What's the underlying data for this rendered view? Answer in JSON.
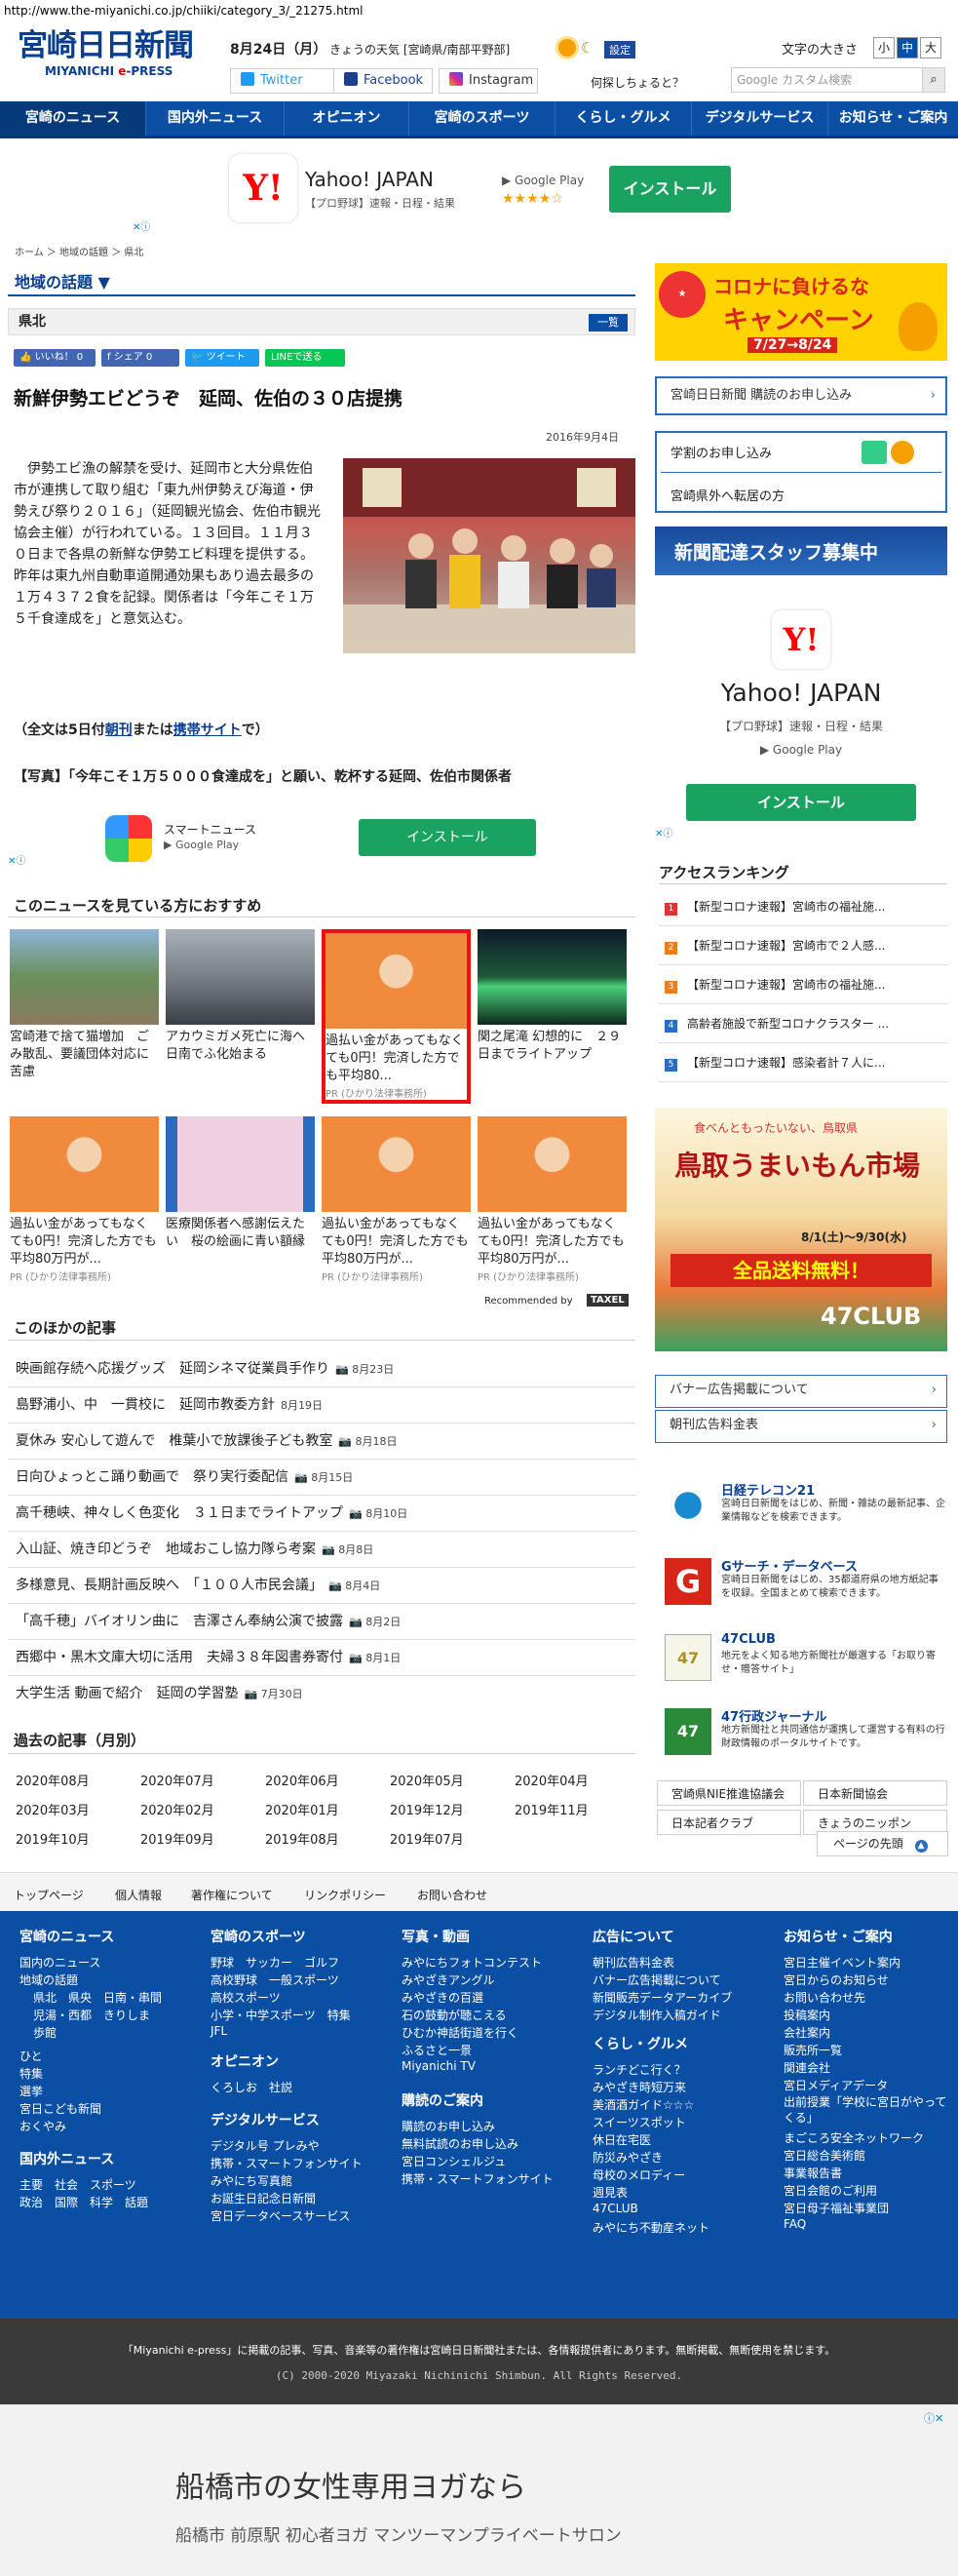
{
  "url": "http://www.the-miyanichi.co.jp/chiiki/category_3/_21275.html",
  "header": {
    "logo_main": "宮崎日日新聞",
    "logo_sub_a": "MIYANICHI ",
    "logo_sub_b": "e",
    "logo_sub_c": "-PRESS",
    "date": "8月24日（月）",
    "weather": "きょうの天気 [宮崎県/南部平野部]",
    "settei": "設定",
    "twitter": "Twitter",
    "facebook": "Facebook",
    "instagram": "Instagram",
    "what": "何探しちょると？",
    "fontsize_label": "文字の大きさ",
    "fs_small": "小",
    "fs_mid": "中",
    "fs_large": "大",
    "search_placeholder": "Google カスタム検索",
    "search_icon": "magnifier"
  },
  "nav": [
    "宮崎のニュース",
    "国内外ニュース",
    "オピニオン",
    "宮崎のスポーツ",
    "くらし・グルメ",
    "デジタルサービス",
    "お知らせ・ご案内"
  ],
  "ad_top": {
    "brand": "Y!",
    "title": "Yahoo! JAPAN",
    "desc": "【プロ野球】速報・日程・結果",
    "store": "▶ Google Play",
    "stars": "★★★★☆",
    "install": "インストール"
  },
  "breadcrumb": "ホーム ＞ 地域の話題 ＞ 県北",
  "section_title": "地域の話題 ▼",
  "subsection": "県北",
  "ichiran": "一覧",
  "share": {
    "like": "👍 いいね！ 0",
    "share": "f シェア 0",
    "tweet": "🐦 ツイート",
    "line": "LINEで送る"
  },
  "article": {
    "title": "新鮮伊勢エビどうぞ　延岡、佐伯の３０店提携",
    "date": "2016年9月4日",
    "body": "　伊勢エビ漁の解禁を受け、延岡市と大分県佐伯市が連携して取り組む「東九州伊勢えび海道・伊勢えび祭り２０１６」（延岡観光協会、佐伯市観光協会主催）が行われている。１３回目。１１月３０日まで各県の新鮮な伊勢エビ料理を提供する。昨年は東九州自動車道開通効果もあり過去最多の１万４３７２食を記録。関係者は「今年こそ１万５千食達成を」と意気込む。",
    "full_a": "（全文は5日付",
    "full_link1": "朝刊",
    "full_b": "または",
    "full_link2": "携帯サイト",
    "full_c": "で）",
    "caption": "【写真】「今年こそ１万５０００食達成を」と願い、乾杯する延岡、佐伯市関係者"
  },
  "ad_small": {
    "title": "スマートニュース",
    "store": "▶ Google Play",
    "install": "インストール"
  },
  "recommend_title": "このニュースを見ている方におすすめ",
  "recommend": [
    {
      "text": "宮崎港で捨て猫増加　ごみ散乱、要議団体対応に苦慮",
      "pr": ""
    },
    {
      "text": "アカウミガメ死亡に海へ　日南でふ化始まる",
      "pr": ""
    },
    {
      "text": "過払い金があってもなくても0円！完済した方でも平均80...",
      "pr": "PR (ひかり法律事務所)"
    },
    {
      "text": "関之尾滝 幻想的に　２９日までライトアップ",
      "pr": ""
    },
    {
      "text": "過払い金があってもなくても0円！完済した方でも平均80万円が...",
      "pr": "PR (ひかり法律事務所)"
    },
    {
      "text": "医療関係者へ感謝伝えたい　桜の絵画に青い額縁",
      "pr": ""
    },
    {
      "text": "過払い金があってもなくても0円！完済した方でも平均80万円が...",
      "pr": "PR (ひかり法律事務所)"
    },
    {
      "text": "過払い金があってもなくても0円！完済した方でも平均80万円が...",
      "pr": "PR (ひかり法律事務所)"
    }
  ],
  "recommended_by": "Recommended by",
  "taxel": "TAXEL",
  "other_title": "このほかの記事",
  "others": [
    {
      "t": "映画館存続へ応援グッズ　延岡シネマ従業員手作り",
      "d": "📷 8月23日"
    },
    {
      "t": "島野浦小、中　一貫校に　延岡市教委方針",
      "d": "8月19日"
    },
    {
      "t": "夏休み 安心して遊んで　椎葉小で放課後子ども教室",
      "d": "📷 8月18日"
    },
    {
      "t": "日向ひょっとこ踊り動画で　祭り実行委配信",
      "d": "📷 8月15日"
    },
    {
      "t": "高千穂峡、神々しく色変化　３１日までライトアップ",
      "d": "📷 8月10日"
    },
    {
      "t": "入山証、焼き印どうぞ　地域おこし協力隊ら考案",
      "d": "📷 8月8日"
    },
    {
      "t": "多様意見、長期計画反映へ　「１００人市民会議」",
      "d": "📷 8月4日"
    },
    {
      "t": "「高千穂」バイオリン曲に　吉澤さん奉納公演で披露",
      "d": "📷 8月2日"
    },
    {
      "t": "西郷中・黒木文庫大切に活用　夫婦３８年図書券寄付",
      "d": "📷 8月1日"
    },
    {
      "t": "大学生活 動画で紹介　延岡の学習塾",
      "d": "📷 7月30日"
    }
  ],
  "past_title": "過去の記事（月別）",
  "months": [
    "2020年08月",
    "2020年07月",
    "2020年06月",
    "2020年05月",
    "2020年04月",
    "2020年03月",
    "2020年02月",
    "2020年01月",
    "2019年12月",
    "2019年11月",
    "2019年10月",
    "2019年09月",
    "2019年08月",
    "2019年07月"
  ],
  "sidebar": {
    "campaign_top": "コロナに負けるな",
    "campaign_main": "キャンペーン",
    "campaign_date": "7/27→8/24",
    "apply": "宮崎日日新聞 購読のお申し込み",
    "gakushu": "学割のお申し込み",
    "tenkyo": "宮崎県外へ転居の方",
    "recruit": "新聞配達スタッフ募集中",
    "yahoo_title": "Yahoo! JAPAN",
    "yahoo_desc": "【プロ野球】速報・日程・結果",
    "yahoo_store": "▶ Google Play",
    "yahoo_install": "インストール",
    "rank_title": "アクセスランキング",
    "ranking": [
      "【新型コロナ速報】宮崎市の福祉施...",
      "【新型コロナ速報】宮崎市で２人感...",
      "【新型コロナ速報】宮崎市の福祉施...",
      "高齢者施設で新型コロナクラスター ...",
      "【新型コロナ速報】感染者計７人に..."
    ],
    "rank_colors": [
      "#d33",
      "#e67e22",
      "#e67e22",
      "#2a6cc0",
      "#2a6cc0"
    ],
    "tottori_top": "食べんともったいない、鳥取県",
    "tottori_main": "鳥取うまいもん市場",
    "tottori_date": "8/1(土)〜9/30(水)",
    "tottori_ship": "全品送料無料！",
    "club": "47CLUB",
    "banner_ad": "バナー広告掲載について",
    "chokan_ad": "朝刊広告料金表",
    "services": [
      {
        "t": "日経テレコン21",
        "d": "宮崎日日新聞をはじめ、新聞・雑誌の最新記事、企業情報などを検索できます。"
      },
      {
        "t": "Gサーチ・データベース",
        "d": "宮崎日日新聞をはじめ、35都道府県の地方紙記事を収録。全国まとめて検索できます。"
      },
      {
        "t": "47CLUB",
        "d": "地元をよく知る地方新聞社が厳選する「お取り寄せ・贈答サイト」"
      },
      {
        "t": "47行政ジャーナル",
        "d": "地方新聞社と共同通信が運携して運営する有料の行財政情報のポータルサイトです。"
      }
    ],
    "mini": [
      "宮崎県NIE推進協議会",
      "日本新聞協会",
      "日本記者クラブ",
      "きょうのニッポン"
    ]
  },
  "footer_links": [
    "トップページ",
    "個人情報",
    "著作権について",
    "リンクポリシー",
    "お問い合わせ"
  ],
  "pagetop": "ページの先頭",
  "fnav": {
    "c1": {
      "h": "宮崎のニュース",
      "items": [
        "国内のニュース",
        "地域の話題",
        "県北　県央　日南・串間",
        "児湯・西都　きりしま",
        "歩館",
        "ひと",
        "特集",
        "選挙",
        "宮日こども新聞",
        "おくやみ"
      ],
      "h2": "国内外ニュース",
      "items2": [
        "主要　社会　スポーツ",
        "政治　国際　科学　話題"
      ]
    },
    "c2": {
      "h": "宮崎のスポーツ",
      "items": [
        "野球　サッカー　ゴルフ",
        "高校野球　一般スポーツ",
        "高校スポーツ",
        "小学・中学スポーツ　特集",
        "JFL"
      ],
      "h2": "オピニオン",
      "items2": [
        "くろしお　社説"
      ],
      "h3": "デジタルサービス",
      "items3": [
        "デジタル号 プレみや",
        "携帯・スマートフォンサイト",
        "みやにち写真館",
        "お誕生日記念日新聞",
        "宮日データベースサービス"
      ]
    },
    "c3": {
      "h": "写真・動画",
      "items": [
        "みやにちフォトコンテスト",
        "みやざきアングル",
        "みやざきの百選",
        "石の鼓動が聴こえる",
        "ひむか神話街道を行く",
        "ふるさと一景",
        "Miyanichi TV"
      ],
      "h2": "購読のご案内",
      "items2": [
        "購読のお申し込み",
        "無料試読のお申し込み",
        "宮日コンシェルジュ",
        "携帯・スマートフォンサイト"
      ]
    },
    "c4": {
      "h": "広告について",
      "items": [
        "朝刊広告料金表",
        "バナー広告掲載について",
        "新聞販売データアーカイブ",
        "デジタル制作入稿ガイド"
      ],
      "h2": "くらし・グルメ",
      "items2": [
        "ランチどこ行く？",
        "みやざき時短万来",
        "美酒酒ガイド☆☆☆",
        "スイーツスポット",
        "休日在宅医",
        "防災みやざき",
        "母校のメロディー",
        "週見表",
        "47CLUB",
        "みやにち不動産ネット"
      ]
    },
    "c5": {
      "h": "お知らせ・ご案内",
      "items": [
        "宮日主催イベント案内",
        "宮日からのお知らせ",
        "お問い合わせ先",
        "投稿案内",
        "会社案内",
        "販売所一覧",
        "関連会社",
        "宮日メディアデータ",
        "出前授業「学校に宮日がやってくる」",
        "まごころ安全ネットワーク",
        "宮日総合美術館",
        "事業報告書",
        "宮日会館のご利用",
        "宮日母子福祉事業団",
        "FAQ"
      ]
    }
  },
  "copyright1": "「Miyanichi e-press」に掲載の記事、写真、音楽等の著作権は宮崎日日新聞社または、各情報提供者にあります。無断掲載、無断使用を禁じます。",
  "copyright2": "(C) 2000-2020 Miyazaki Nichinichi Shimbun. All Rights Reserved.",
  "ad_bottom": {
    "title": "船橋市の女性専用ヨガなら",
    "desc": "船橋市 前原駅 初心者ヨガ マンツーマンプライベートサロン"
  }
}
